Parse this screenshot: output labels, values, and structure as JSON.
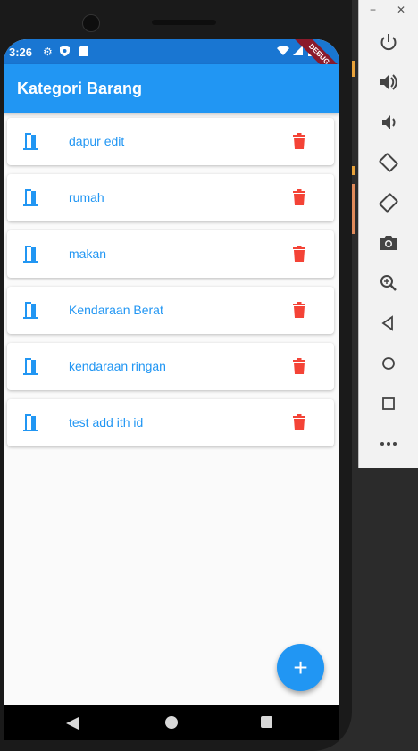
{
  "status_bar": {
    "time": "3:26",
    "debug_banner": "DEBUG"
  },
  "app_bar": {
    "title": "Kategori Barang"
  },
  "categories": [
    {
      "name": "dapur edit"
    },
    {
      "name": "rumah"
    },
    {
      "name": "makan"
    },
    {
      "name": "Kendaraan Berat"
    },
    {
      "name": "kendaraan ringan"
    },
    {
      "name": "test add ith id"
    }
  ],
  "fab": {
    "label": "+"
  },
  "emulator": {
    "minimize": "−",
    "close": "✕"
  },
  "colors": {
    "primary": "#2196f3",
    "primary_dark": "#1976d2",
    "delete": "#f44336"
  }
}
